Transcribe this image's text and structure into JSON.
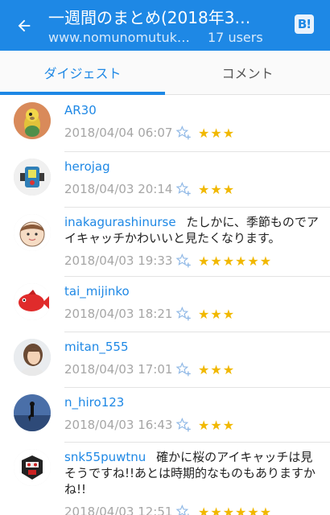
{
  "header": {
    "title": "一週間のまとめ(2018年3…",
    "url": "www.nomunomutuk…",
    "users": "17 users",
    "hatena_badge": "B!"
  },
  "tabs": [
    {
      "label": "ダイジェスト",
      "active": true
    },
    {
      "label": "コメント",
      "active": false
    }
  ],
  "colors": {
    "brand": "#1e88e5",
    "star": "#f1b800"
  },
  "comments": [
    {
      "user": "AR30",
      "text": "",
      "date": "2018/04/04 06:07",
      "stars": "★★★",
      "star_count": 3
    },
    {
      "user": "herojag",
      "text": "",
      "date": "2018/04/03 20:14",
      "stars": "★★★",
      "star_count": 3
    },
    {
      "user": "inakagurashinurse",
      "text": "たしかに、季節ものでアイキャッチかわいいと見たくなります。",
      "date": "2018/04/03 19:33",
      "stars": "★★★★★★",
      "star_count": 6
    },
    {
      "user": "tai_mijinko",
      "text": "",
      "date": "2018/04/03 18:21",
      "stars": "★★★",
      "star_count": 3
    },
    {
      "user": "mitan_555",
      "text": "",
      "date": "2018/04/03 17:01",
      "stars": "★★★",
      "star_count": 3
    },
    {
      "user": "n_hiro123",
      "text": "",
      "date": "2018/04/03 16:43",
      "stars": "★★★",
      "star_count": 3
    },
    {
      "user": "snk55puwtnu",
      "text": "確かに桜のアイキャッチは見そうですね!!あとは時期的なものもありますかね!!",
      "date": "2018/04/03 12:51",
      "stars": "★★★★★★",
      "star_count": 6
    }
  ]
}
